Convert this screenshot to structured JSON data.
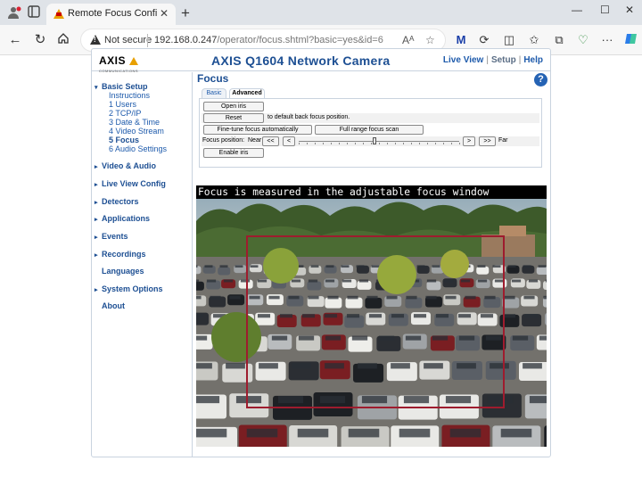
{
  "browser": {
    "tab_title": "Remote Focus Configuration - AXIS",
    "url_host": "192.168.0.247",
    "url_path": "/operator/focus.shtml?basic=yes&id=6",
    "security_label": "Not secure"
  },
  "header": {
    "logo_text": "AXIS",
    "logo_sub": "COMMUNICATIONS",
    "camera_title": "AXIS Q1604 Network Camera",
    "links": [
      "Live View",
      "Setup",
      "Help"
    ]
  },
  "sidebar": {
    "sections": [
      {
        "label": "Basic Setup",
        "expanded": true
      },
      {
        "label": "Video & Audio"
      },
      {
        "label": "Live View Config"
      },
      {
        "label": "Detectors"
      },
      {
        "label": "Applications"
      },
      {
        "label": "Events"
      },
      {
        "label": "Recordings"
      },
      {
        "label": "Languages"
      },
      {
        "label": "System Options"
      },
      {
        "label": "About"
      }
    ],
    "basic_items": [
      "Instructions",
      "1 Users",
      "2 TCP/IP",
      "3 Date & Time",
      "4 Video Stream",
      "5 Focus",
      "6 Audio Settings"
    ]
  },
  "content": {
    "title": "Focus",
    "help": "?",
    "tabs": [
      "Basic",
      "Advanced"
    ],
    "open_iris": "Open iris",
    "reset": "Reset",
    "reset_desc": "to default back focus position.",
    "fine_tune": "Fine-tune focus automatically",
    "full_range": "Full range focus scan",
    "focus_position_label": "Focus position:",
    "near_label": "Near",
    "far_label": "Far",
    "btn_far_left": "<<",
    "btn_left": "<",
    "btn_right": ">",
    "btn_far_right": ">>",
    "enable_iris": "Enable iris",
    "focus_position_value": 0.47,
    "overlay_text": "Focus is measured in the adjustable focus window"
  },
  "colors": {
    "heading_blue": "#1d4f93",
    "link_blue": "#1d5aab",
    "focus_window": "#9e1c2e"
  }
}
